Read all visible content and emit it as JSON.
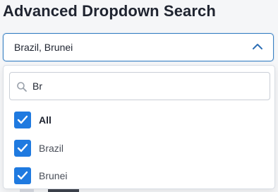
{
  "header": {
    "title": "Advanced Dropdown Search"
  },
  "select": {
    "value": "Brazil, Brunei",
    "expanded": true
  },
  "dropdown": {
    "search": {
      "value": "Br",
      "placeholder": ""
    },
    "options": [
      {
        "label": "All",
        "checked": true
      },
      {
        "label": "Brazil",
        "checked": true
      },
      {
        "label": "Brunei",
        "checked": true
      }
    ]
  },
  "colors": {
    "accent": "#1f7ae0",
    "focus_border": "#3b82c4",
    "text": "#1f2430"
  },
  "icons": {
    "toggle": "chevron-up-icon",
    "search": "search-icon",
    "check": "check-icon"
  }
}
